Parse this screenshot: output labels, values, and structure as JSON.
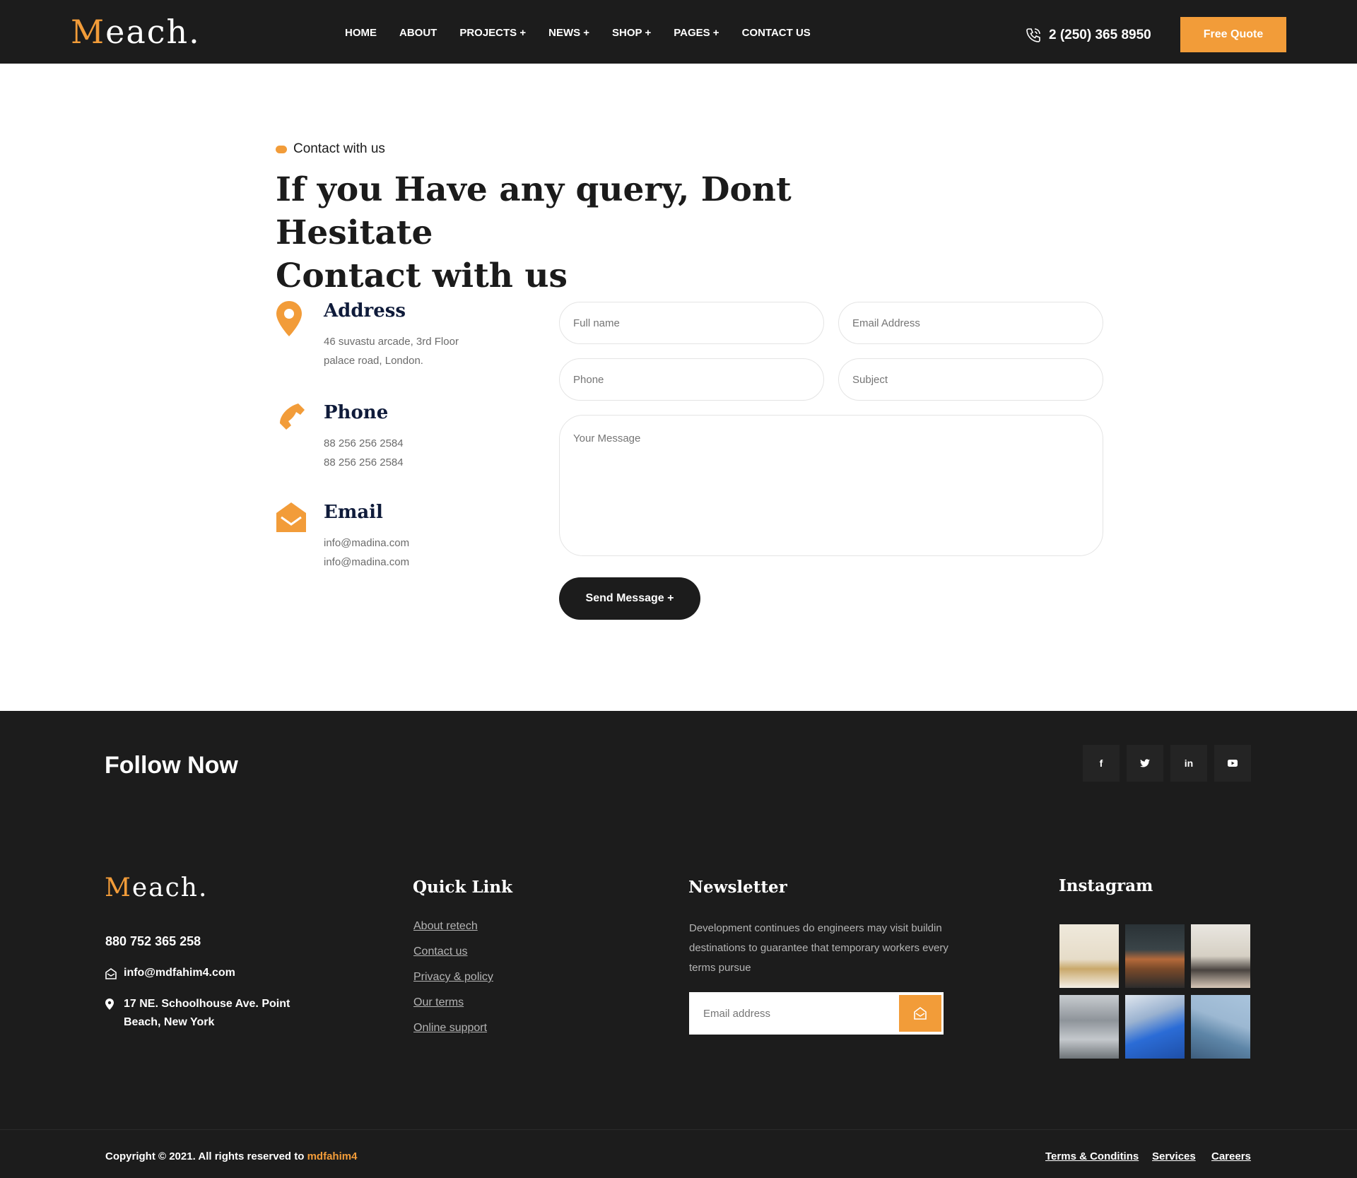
{
  "brand": {
    "first_letter": "M",
    "rest": "each."
  },
  "nav": {
    "items": [
      "HOME",
      "ABOUT",
      "PROJECTS +",
      "NEWS +",
      "SHOP +",
      "PAGES +",
      "CONTACT US"
    ],
    "phone": "2 (250) 365 8950",
    "quote_label": "Free Quote"
  },
  "contact": {
    "tagline": "Contact with us",
    "heading_line1": "If you Have any query, Dont Hesitate",
    "heading_line2": "Contact with us",
    "address": {
      "title": "Address",
      "line1": "46 suvastu arcade, 3rd Floor",
      "line2": "palace road, London."
    },
    "phone": {
      "title": "Phone",
      "line1": "88 256 256 2584",
      "line2": "88 256 256 2584"
    },
    "email": {
      "title": "Email",
      "line1": "info@madina.com",
      "line2": "info@madina.com"
    }
  },
  "form": {
    "full_name_placeholder": "Full name",
    "email_placeholder": "Email Address",
    "phone_placeholder": "Phone",
    "subject_placeholder": "Subject",
    "message_placeholder": "Your Message",
    "send_label": "Send Message +"
  },
  "footer": {
    "follow_title": "Follow Now",
    "social": [
      "f",
      "t",
      "in",
      "yt"
    ],
    "phone": "880 752 365 258",
    "email": "info@mdfahim4.com",
    "address_line1": "17 NE. Schoolhouse Ave. Point",
    "address_line2": "Beach, New York",
    "quick_link_title": "Quick Link",
    "quick_links": [
      "About retech",
      "Contact us",
      "Privacy & policy",
      "Our terms",
      "Online support"
    ],
    "newsletter_title": "Newsletter",
    "newsletter_text": "Development continues do engineers may visit buildin destinations to guarantee that temporary workers every terms pursue",
    "newsletter_placeholder": "Email address",
    "instagram_title": "Instagram",
    "copyright_prefix": "Copyright © 2021. All rights reserved to ",
    "copyright_owner": "mdfahim4",
    "bottom_links": [
      "Terms & Conditins",
      "Services",
      "Careers"
    ]
  },
  "colors": {
    "accent": "#f29c39",
    "dark": "#1c1c1c",
    "navy": "#0f1b3a"
  }
}
